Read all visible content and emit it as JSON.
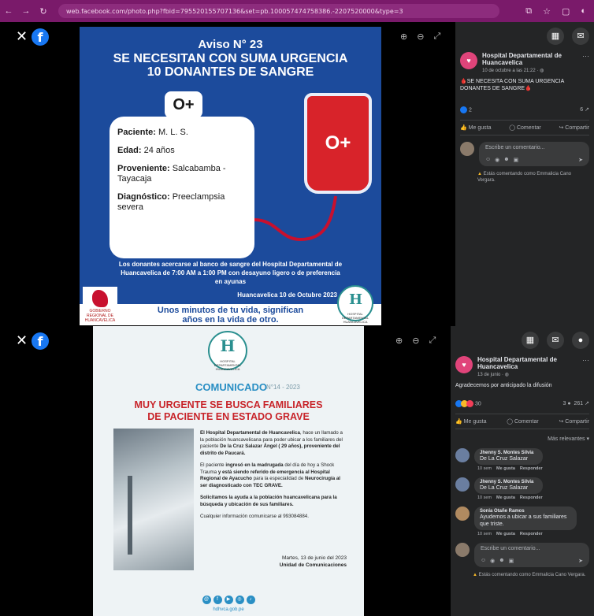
{
  "browser": {
    "url": "web.facebook.com/photo.php?fbid=795520155707136&set=pb.100057474758386.-2207520000&type=3"
  },
  "post1": {
    "poster": {
      "aviso": "Aviso N° 23",
      "headline1": "SE NECESITAN CON SUMA URGENCIA",
      "headline2": "10 DONANTES DE SANGRE",
      "blood_type": "O+",
      "paciente_label": "Paciente:",
      "paciente_value": "M. L. S.",
      "edad_label": "Edad:",
      "edad_value": "24 años",
      "proveniente_label": "Proveniente:",
      "proveniente_value": "Salcabamba - Tayacaja",
      "diagnostico_label": "Diagnóstico:",
      "diagnostico_value": "Preeclampsia severa",
      "donors_text": "Los donantes acercarse al banco de sangre del Hospital Departamental de Huancavelica de 7:00 AM a 1:00 PM con desayuno ligero o de preferencia en ayunas",
      "date": "Huancavelica 10 de Octubre 2023",
      "slogan1": "Unos minutos de tu vida, significan",
      "slogan2": "años en la vida de otro.",
      "gov_logo_text": "GOBIERNO REGIONAL DE HUANCAVELICA",
      "hospital_logo_text": "HOSPITAL DEPARTAMENTAL HUANCAVELICA"
    },
    "sidebar": {
      "page_name": "Hospital Departamental de Huancavelica",
      "meta": "10 de octubre a las 21:22 · ",
      "text": "🩸SE NECESITA CON SUMA URGENCIA DONANTES DE SANGRE🩸",
      "reactions": "2",
      "shares": "6",
      "like": "Me gusta",
      "comment": "Comentar",
      "share": "Compartir",
      "comment_placeholder": "Escribe un comentario...",
      "note": "Estás comentando como Emmalicia Cano Vergara."
    }
  },
  "post2": {
    "poster": {
      "logo_text": "HOSPITAL DEPARTAMENTAL HUANCAVELICA",
      "comunicado": "COMUNICADO",
      "number": "N°14 - 2023",
      "title1": "MUY URGENTE SE BUSCA FAMILIARES",
      "title2": "DE PACIENTE EN ESTADO GRAVE",
      "para1_a": "El Hospital Departamental de Huancavelica",
      "para1_b": ", hace un llamado a la población huancavelicana para poder ubicar a los familiares del paciente ",
      "para1_c": "De la Cruz Salazar Ángel ( 29 años), proveniente del distrito de Paucará.",
      "para2_a": "El paciente ",
      "para2_b": "ingresó en la madrugada",
      "para2_c": " del día de hoy a Shock Trauma ",
      "para2_d": "y está siendo referido de emergencia al Hospital Regional de Ayacucho",
      "para2_e": " para la especialidad de ",
      "para2_f": "Neurocirugía al ser diagnosticado con TEC GRAVE.",
      "para3": "Solicitamos la ayuda a la población huancavelicana para la búsqueda y ubicación de sus familiares.",
      "para4": "Cualquier información comunicarse al 993084884.",
      "sign_date": "Martes, 13 de junio del 2023",
      "sign_unit": "Unidad de Comunicaciones",
      "website": "hdhvca.gob.pe"
    },
    "sidebar": {
      "page_name": "Hospital Departamental de Huancavelica",
      "meta": "13 de junio · ",
      "text": "Agradecemos por anticipado la difusión",
      "reactions": "30",
      "comments": "3",
      "shares": "261",
      "like": "Me gusta",
      "comment": "Comentar",
      "share": "Compartir",
      "sort": "Más relevantes",
      "comments_list": [
        {
          "name": "Jhenny S. Montes Silvia",
          "text": "De La Cruz Salazar",
          "time": "10 sem",
          "like": "Me gusta",
          "reply": "Responder"
        },
        {
          "name": "Jhenny S. Montes Silvia",
          "text": "De La Cruz Salazar",
          "time": "10 sem",
          "like": "Me gusta",
          "reply": "Responder"
        },
        {
          "name": "Sonia Otañe Ramos",
          "text": "Ayudemos a ubicar a sus familiares que triste.",
          "time": "10 sem",
          "like": "Me gusta",
          "reply": "Responder"
        }
      ],
      "comment_placeholder": "Escribe un comentario...",
      "note": "Estás comentando como Emmalicia Cano Vergara."
    }
  },
  "colors": {
    "chrome": "#7a1a6a",
    "poster_blue": "#1c4b9c",
    "blood_red": "#d8232a",
    "fb_blue": "#1877f2",
    "sidebar_bg": "#242526"
  }
}
